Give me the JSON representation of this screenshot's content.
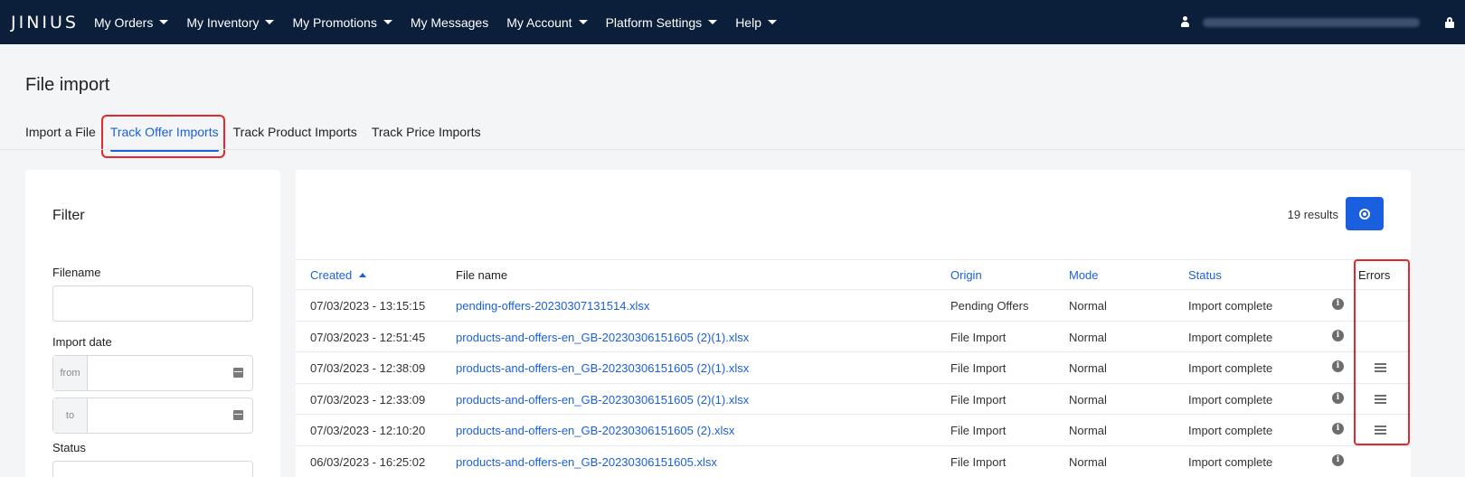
{
  "navbar": {
    "logo": "JINIUS",
    "items": [
      {
        "label": "My Orders",
        "dropdown": true
      },
      {
        "label": "My Inventory",
        "dropdown": true
      },
      {
        "label": "My Promotions",
        "dropdown": true
      },
      {
        "label": "My Messages",
        "dropdown": false
      },
      {
        "label": "My Account",
        "dropdown": true
      },
      {
        "label": "Platform Settings",
        "dropdown": true
      },
      {
        "label": "Help",
        "dropdown": true
      }
    ]
  },
  "page": {
    "title": "File import",
    "tabs": [
      {
        "label": "Import a File",
        "active": false
      },
      {
        "label": "Track Offer Imports",
        "active": true
      },
      {
        "label": "Track Product Imports",
        "active": false
      },
      {
        "label": "Track Price Imports",
        "active": false
      }
    ]
  },
  "filter": {
    "title": "Filter",
    "filename_label": "Filename",
    "import_date_label": "Import date",
    "from_label": "from",
    "to_label": "to",
    "status_label": "Status"
  },
  "results": {
    "count_text": "19 results",
    "columns": {
      "created": "Created",
      "file_name": "File name",
      "origin": "Origin",
      "mode": "Mode",
      "status": "Status",
      "errors": "Errors"
    },
    "rows": [
      {
        "created": "07/03/2023 - 13:15:15",
        "file_name": "pending-offers-20230307131514.xlsx",
        "origin": "Pending Offers",
        "mode": "Normal",
        "status": "Import complete",
        "has_errors": false
      },
      {
        "created": "07/03/2023 - 12:51:45",
        "file_name": "products-and-offers-en_GB-20230306151605 (2)(1).xlsx",
        "origin": "File Import",
        "mode": "Normal",
        "status": "Import complete",
        "has_errors": false
      },
      {
        "created": "07/03/2023 - 12:38:09",
        "file_name": "products-and-offers-en_GB-20230306151605 (2)(1).xlsx",
        "origin": "File Import",
        "mode": "Normal",
        "status": "Import complete",
        "has_errors": true
      },
      {
        "created": "07/03/2023 - 12:33:09",
        "file_name": "products-and-offers-en_GB-20230306151605 (2)(1).xlsx",
        "origin": "File Import",
        "mode": "Normal",
        "status": "Import complete",
        "has_errors": true
      },
      {
        "created": "07/03/2023 - 12:10:20",
        "file_name": "products-and-offers-en_GB-20230306151605 (2).xlsx",
        "origin": "File Import",
        "mode": "Normal",
        "status": "Import complete",
        "has_errors": true
      },
      {
        "created": "06/03/2023 - 16:25:02",
        "file_name": "products-and-offers-en_GB-20230306151605.xlsx",
        "origin": "File Import",
        "mode": "Normal",
        "status": "Import complete",
        "has_errors": false
      }
    ]
  },
  "colors": {
    "navbar_bg": "#0b1f3a",
    "accent": "#1a5fe0",
    "highlight": "#e0282e",
    "page_bg": "#f4f5f7"
  },
  "icons": {
    "info": "i",
    "user": "user-icon",
    "lock": "lock-icon",
    "calendar": "calendar-icon",
    "errors": "list-icon",
    "download": "download-icon"
  }
}
